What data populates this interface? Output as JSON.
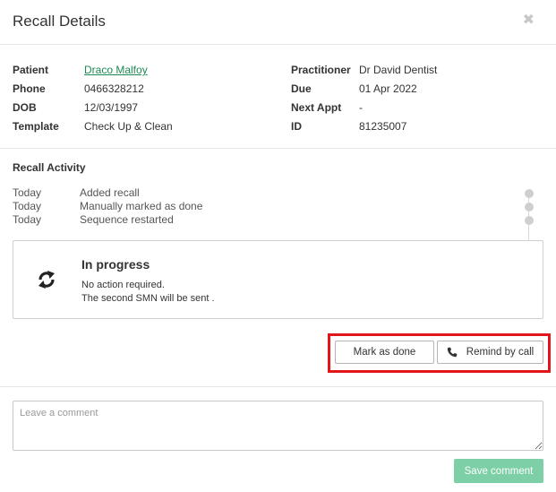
{
  "modal": {
    "title": "Recall Details",
    "close_icon": "close-icon"
  },
  "details": {
    "patient_label": "Patient",
    "patient_value": "Draco Malfoy",
    "phone_label": "Phone",
    "phone_value": "0466328212",
    "dob_label": "DOB",
    "dob_value": "12/03/1997",
    "template_label": "Template",
    "template_value": "Check Up & Clean",
    "practitioner_label": "Practitioner",
    "practitioner_value": "Dr David Dentist",
    "due_label": "Due",
    "due_value": "01 Apr 2022",
    "next_appt_label": "Next Appt",
    "next_appt_value": "-",
    "id_label": "ID",
    "id_value": "81235007"
  },
  "activity": {
    "title": "Recall Activity",
    "items": [
      {
        "date": "Today",
        "text": "Added recall"
      },
      {
        "date": "Today",
        "text": "Manually marked as done"
      },
      {
        "date": "Today",
        "text": "Sequence restarted"
      }
    ]
  },
  "status": {
    "icon": "refresh-icon",
    "title": "In progress",
    "line1": "No action required.",
    "line2": "The second SMN will be sent ."
  },
  "actions": {
    "mark_done_label": "Mark as done",
    "remind_label": "Remind by call",
    "remind_icon": "phone-icon"
  },
  "comment": {
    "placeholder": "Leave a comment",
    "save_label": "Save comment"
  },
  "colors": {
    "link": "#1e8a55",
    "save_button": "#7ccfa6",
    "highlight": "#e0161b"
  }
}
